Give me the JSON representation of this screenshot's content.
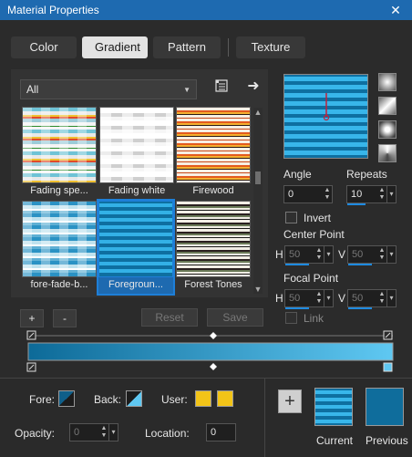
{
  "window": {
    "title": "Material Properties",
    "close": "✕"
  },
  "tabs": [
    "Color",
    "Gradient",
    "Pattern",
    "Texture"
  ],
  "dropdown": {
    "value": "All"
  },
  "thumbnails": [
    "Fading spe...",
    "Fading white",
    "Firewood",
    "fore-fade-b...",
    "Foregroun...",
    "Forest Tones"
  ],
  "list_buttons": {
    "add": "+",
    "remove": "-",
    "reset": "Reset",
    "save": "Save"
  },
  "angle": {
    "label": "Angle",
    "value": "0"
  },
  "repeats": {
    "label": "Repeats",
    "value": "10"
  },
  "invert": {
    "label": "Invert",
    "checked": false
  },
  "center_point": {
    "label": "Center Point",
    "h_label": "H",
    "h": "50",
    "v_label": "V",
    "v": "50"
  },
  "focal_point": {
    "label": "Focal Point",
    "h_label": "H",
    "h": "50",
    "v_label": "V",
    "v": "50"
  },
  "link": {
    "label": "Link"
  },
  "footer": {
    "fore_label": "Fore:",
    "back_label": "Back:",
    "user_label": "User:",
    "opacity_label": "Opacity:",
    "opacity": "0",
    "location_label": "Location:",
    "location": "0",
    "current_label": "Current",
    "previous_label": "Previous",
    "add": "+"
  },
  "colors": {
    "accent": "#1e6ab0",
    "user_swatch": "#f2c418",
    "previous_swatch": "#0f6d9c"
  }
}
